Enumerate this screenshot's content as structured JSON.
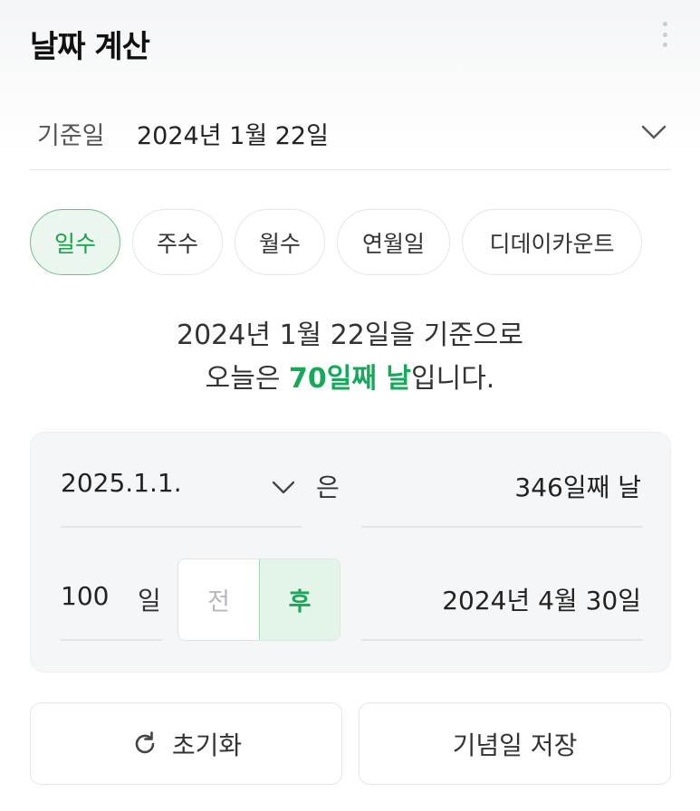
{
  "header": {
    "title": "날짜 계산"
  },
  "base_date": {
    "label": "기준일",
    "value": "2024년 1월 22일"
  },
  "tabs": [
    {
      "label": "일수",
      "active": true
    },
    {
      "label": "주수",
      "active": false
    },
    {
      "label": "월수",
      "active": false
    },
    {
      "label": "연월일",
      "active": false
    },
    {
      "label": "디데이카운트",
      "active": false
    }
  ],
  "summary": {
    "line1": "2024년 1월 22일을 기준으로",
    "line2_prefix": "오늘은 ",
    "line2_highlight": "70일째 날",
    "line2_suffix": "입니다."
  },
  "calc": {
    "date_value": "2025.1.1.",
    "date_particle": "은",
    "date_result": "346일째 날",
    "days_value": "100",
    "days_unit": "일",
    "before_label": "전",
    "after_label": "후",
    "selected": "후",
    "days_result": "2024년 4월 30일"
  },
  "actions": {
    "reset_label": "초기화",
    "save_label": "기념일 저장"
  },
  "colors": {
    "accent": "#17a85a",
    "accent_bg": "#eaf6ee",
    "card_bg": "#f5f6f8"
  },
  "icons": {
    "more": "more-vertical-icon",
    "chevron": "chevron-down-icon",
    "reset": "refresh-icon"
  }
}
